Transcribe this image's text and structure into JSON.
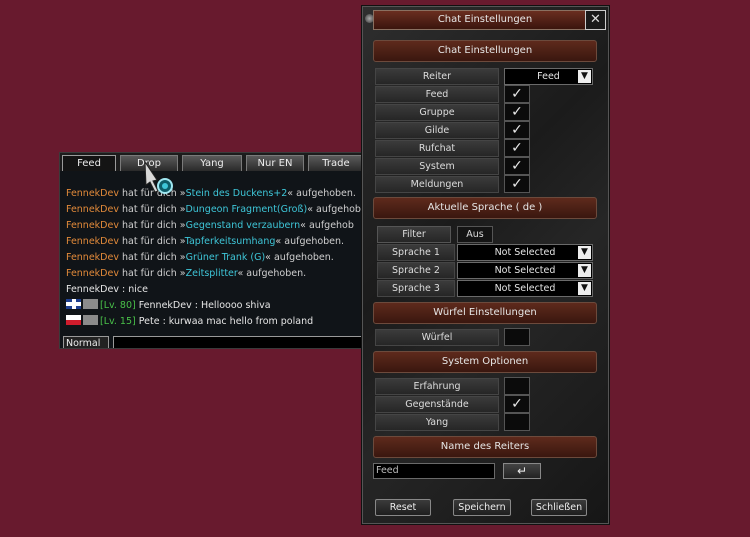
{
  "chat": {
    "tabs": [
      "Feed",
      "Drop",
      "Yang",
      "Nur EN",
      "Trade"
    ],
    "lines": [
      {
        "name": "FennekDev",
        "text": " hat für dich »",
        "item": "Stein des Duckens+2",
        "tail": "« aufgehoben."
      },
      {
        "name": "FennekDev",
        "text": " hat für dich »",
        "item": "Dungeon Fragment(Groß)",
        "tail": "« aufgehob"
      },
      {
        "name": "FennekDev",
        "text": " hat für dich »",
        "item": "Gegenstand verzaubern",
        "tail": "« aufgehob"
      },
      {
        "name": "FennekDev",
        "text": " hat für dich »",
        "item": "Tapferkeitsumhang",
        "tail": "« aufgehoben."
      },
      {
        "name": "FennekDev",
        "text": " hat für dich »",
        "item": "Grüner Trank (G)",
        "tail": "« aufgehoben."
      },
      {
        "name": "FennekDev",
        "text": " hat für dich »",
        "item": "Zeitsplitter",
        "tail": "« aufgehoben."
      }
    ],
    "plain_line": "FennekDev : nice",
    "msg1": {
      "level": "[Lv. 80]",
      "text": " FennekDev : Helloooo shiva"
    },
    "msg2": {
      "level": "[Lv. 15]",
      "text": " Pete : kurwaa mac hello from poland"
    },
    "mode": "Normal",
    "cursor_icon": "game-cursor-icon"
  },
  "settings": {
    "title": "Chat Einstellungen",
    "close_glyph": "✕",
    "section_chat": "Chat Einstellungen",
    "reiter_label": "Reiter",
    "reiter_value": "Feed",
    "channels": [
      {
        "label": "Feed",
        "checked": "✓"
      },
      {
        "label": "Gruppe",
        "checked": "✓"
      },
      {
        "label": "Gilde",
        "checked": "✓"
      },
      {
        "label": "Rufchat",
        "checked": "✓"
      },
      {
        "label": "System",
        "checked": "✓"
      },
      {
        "label": "Meldungen",
        "checked": "✓"
      }
    ],
    "section_lang": "Aktuelle Sprache ( de )",
    "filter_label": "Filter",
    "filter_value": "Aus",
    "languages": [
      {
        "label": "Sprache 1",
        "value": "Not Selected"
      },
      {
        "label": "Sprache 2",
        "value": "Not Selected"
      },
      {
        "label": "Sprache 3",
        "value": "Not Selected"
      }
    ],
    "section_dice": "Würfel Einstellungen",
    "dice_label": "Würfel",
    "section_system": "System Optionen",
    "system_opts": [
      {
        "label": "Erfahrung",
        "checked": ""
      },
      {
        "label": "Gegenstände",
        "checked": "✓"
      },
      {
        "label": "Yang",
        "checked": ""
      }
    ],
    "section_name": "Name des Reiters",
    "name_value": "Feed",
    "enter_glyph": "↵",
    "reset_label": "Reset",
    "save_label": "Speichern",
    "close_label": "Schließen"
  },
  "colors": {
    "background": "#681a2e",
    "item": "#3ec6d8",
    "player": "#e28a3a",
    "level": "#49c049"
  }
}
